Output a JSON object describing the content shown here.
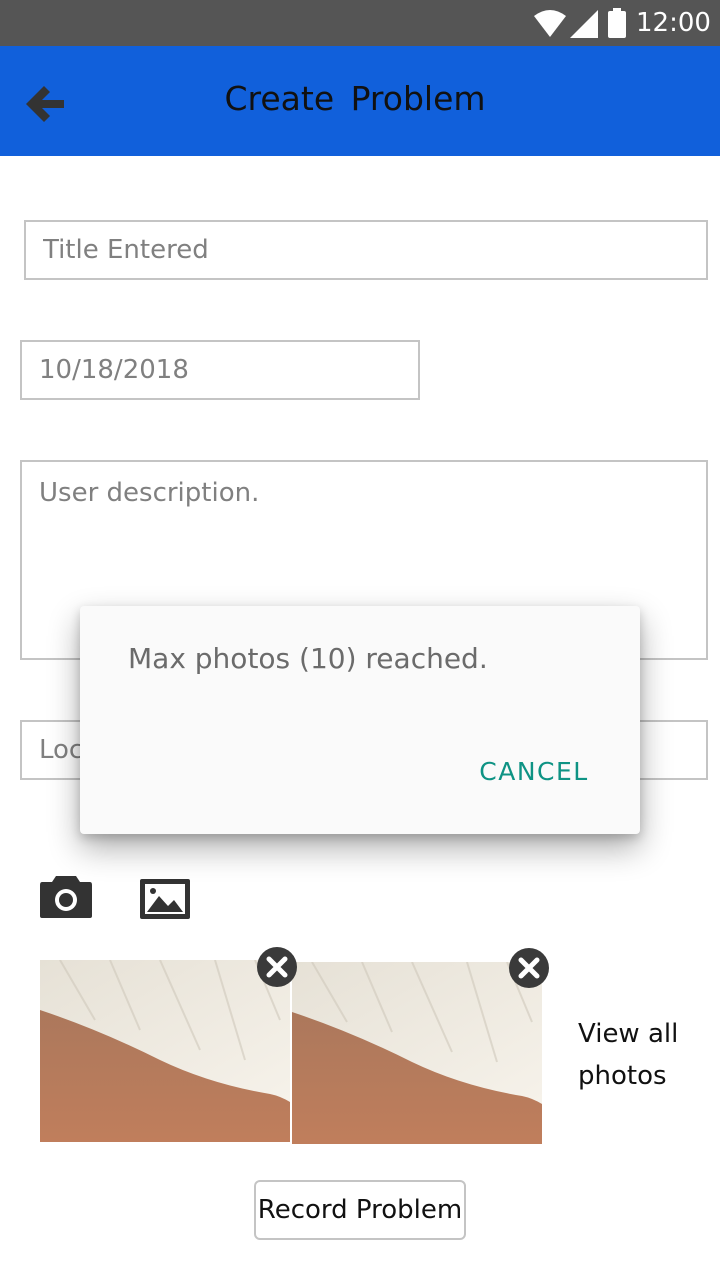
{
  "status_bar": {
    "time": "12:00",
    "icons": [
      "wifi-icon",
      "cellular-signal-icon",
      "battery-icon"
    ]
  },
  "app_bar": {
    "back_icon": "arrow-back-icon",
    "title": "Create  Problem",
    "color": "#1160DB"
  },
  "form": {
    "title_value": "Title Entered",
    "date_value": "10/18/2018",
    "description_placeholder": "User description.",
    "location_placeholder": "Location"
  },
  "media": {
    "camera_icon": "camera-icon",
    "gallery_icon": "image-icon",
    "photos": [
      {
        "remove_icon": "close-circle-icon"
      },
      {
        "remove_icon": "close-circle-icon"
      }
    ],
    "view_all_label": "View all photos"
  },
  "record_button_label": "Record Problem",
  "dialog": {
    "message": "Max photos (10) reached.",
    "cancel_label": "CANCEL",
    "accent_color": "#0E9384"
  }
}
